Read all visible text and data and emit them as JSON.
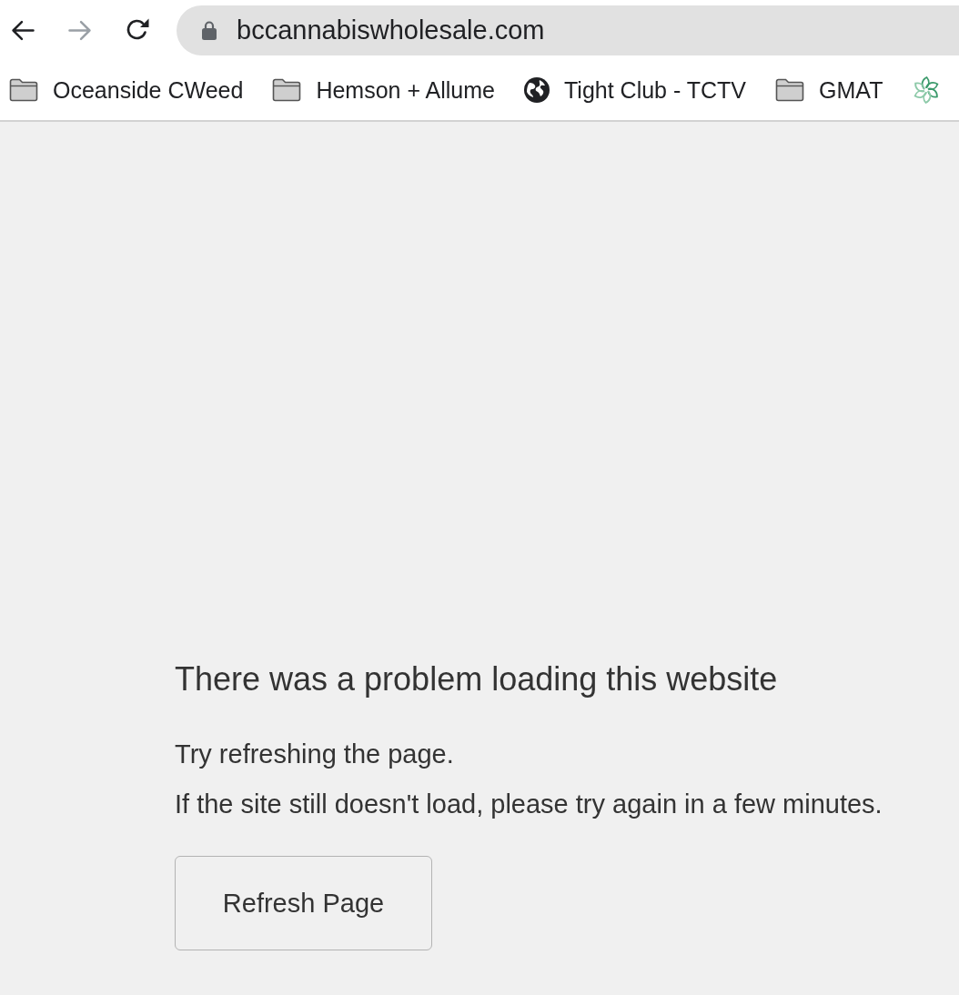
{
  "browser": {
    "nav_buttons": [
      {
        "kind": "back",
        "disabled": false
      },
      {
        "kind": "forward",
        "disabled": true
      },
      {
        "kind": "reload",
        "disabled": false
      }
    ],
    "secure": true,
    "address": "bccannabiswholesale.com"
  },
  "bookmarks": [
    {
      "kind": "folder",
      "label": "Oceanside CWeed"
    },
    {
      "kind": "folder",
      "label": "Hemson + Allume"
    },
    {
      "kind": "globe",
      "label": "Tight Club - TCTV"
    },
    {
      "kind": "folder",
      "label": "GMAT"
    },
    {
      "kind": "swirl"
    }
  ],
  "error": {
    "title": "There was a problem loading this website",
    "lines": [
      "Try refreshing the page.",
      "If the site still doesn't load, please try again in a few minutes."
    ],
    "button": "Refresh Page"
  }
}
